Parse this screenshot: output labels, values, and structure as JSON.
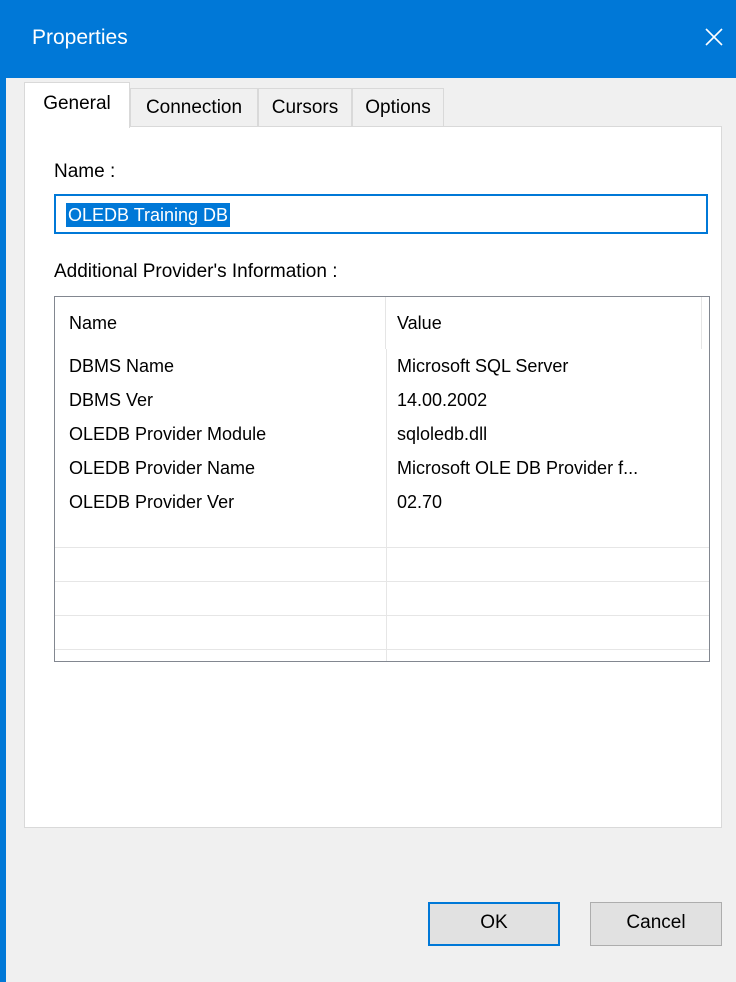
{
  "window": {
    "title": "Properties"
  },
  "tabs": [
    {
      "label": "General"
    },
    {
      "label": "Connection"
    },
    {
      "label": "Cursors"
    },
    {
      "label": "Options"
    }
  ],
  "general": {
    "name_label": "Name :",
    "name_value": "OLEDB Training DB",
    "info_label": "Additional Provider's Information :",
    "columns": [
      "Name",
      "Value"
    ],
    "rows": [
      {
        "name": "DBMS Name",
        "value": "Microsoft SQL Server"
      },
      {
        "name": "DBMS Ver",
        "value": "14.00.2002"
      },
      {
        "name": "OLEDB Provider Module",
        "value": "sqloledb.dll"
      },
      {
        "name": "OLEDB Provider Name",
        "value": "Microsoft OLE DB Provider f..."
      },
      {
        "name": "OLEDB Provider Ver",
        "value": "02.70"
      }
    ]
  },
  "buttons": {
    "ok": "OK",
    "cancel": "Cancel"
  },
  "colors": {
    "accent": "#0078d7",
    "background": "#f0f0f0",
    "panel": "#ffffff"
  },
  "icons": {
    "close": "close-icon"
  }
}
